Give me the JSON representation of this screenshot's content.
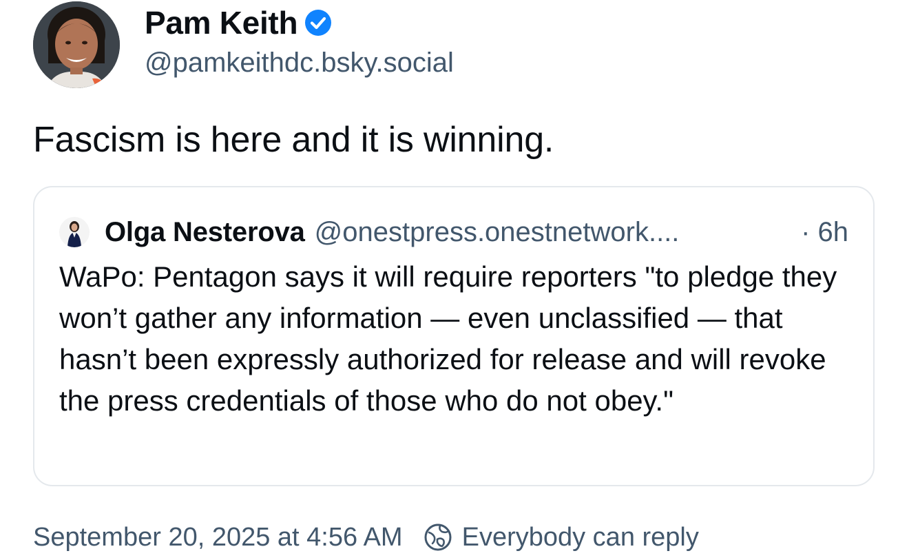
{
  "post": {
    "author": {
      "display_name": "Pam Keith",
      "handle": "@pamkeithdc.bsky.social",
      "verified_icon": "verified-check-icon"
    },
    "text": "Fascism is here and it is winning.",
    "quote": {
      "author_name": "Olga Nesterova",
      "author_handle": "@onestpress.onestnetwork....",
      "time": "· 6h",
      "text": "WaPo: Pentagon says it will require reporters \"to pledge they won’t gather any information — even unclassified — that hasn’t been expressly authorized for release and will revoke the press credentials of those who do not obey.\""
    },
    "timestamp": "September 20, 2025 at 4:56 AM",
    "reply_setting": "Everybody can reply"
  },
  "colors": {
    "text_primary": "#0b0f14",
    "text_secondary": "#42576c",
    "verified_blue": "#1083fe",
    "card_border": "#e4e8ec"
  }
}
